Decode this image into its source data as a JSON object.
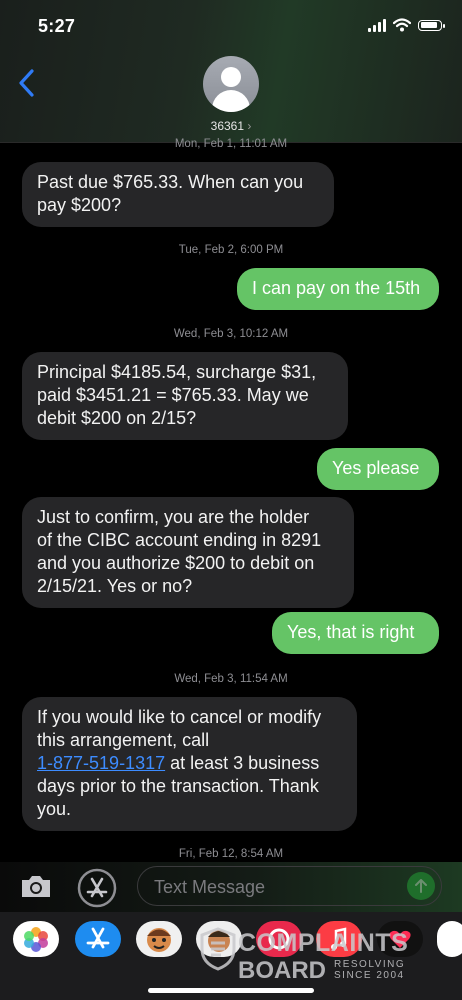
{
  "status_bar": {
    "time": "5:27"
  },
  "header": {
    "contact": "36361",
    "chevron": "›"
  },
  "messages": [
    {
      "type": "timestamp",
      "text": "Mon, Feb 1, 11:01 AM"
    },
    {
      "type": "incoming",
      "lines": [
        "Past due $765.33. When can you",
        "pay $200?"
      ]
    },
    {
      "type": "timestamp",
      "text": "Tue, Feb 2, 6:00 PM"
    },
    {
      "type": "outgoing",
      "text": "I can pay on the 15th"
    },
    {
      "type": "timestamp",
      "text": "Wed, Feb 3, 10:12 AM"
    },
    {
      "type": "incoming",
      "lines": [
        "Principal $4185.54, surcharge $31,",
        "paid $3451.21 = $765.33. May we",
        "debit $200 on 2/15?"
      ]
    },
    {
      "type": "outgoing",
      "text": "Yes please"
    },
    {
      "type": "incoming",
      "lines": [
        "Just to confirm, you are the holder",
        "of the CIBC account ending in 8291",
        "and you authorize $200 to debit on",
        "2/15/21. Yes or no?"
      ]
    },
    {
      "type": "outgoing",
      "text": "Yes, that is right"
    },
    {
      "type": "timestamp",
      "text": "Wed, Feb 3, 11:54 AM"
    },
    {
      "type": "incoming",
      "line1": "If you would like to cancel or modify",
      "line2": "this arrangement, call",
      "phone": "1-877-519-1317",
      "line3_rest": " at least 3 business",
      "line4": "days prior to the transaction. Thank",
      "line5": "you."
    },
    {
      "type": "timestamp",
      "text": "Fri, Feb 12, 8:54 AM"
    }
  ],
  "input": {
    "placeholder": "Text Message"
  },
  "icons": {
    "back": "chevron-left-icon",
    "camera": "camera-icon",
    "appstore": "app-store-icon",
    "send": "send-arrow-icon"
  },
  "colors": {
    "outgoing_bubble": "#65c466",
    "incoming_bubble": "#262628",
    "link": "#3d8cff",
    "accent_blue": "#2f7bf6"
  },
  "watermark": {
    "brand_line1": "COMPLAINTS",
    "brand_line2": "BOARD",
    "tagline_1": "RESOLVING",
    "tagline_2": "SINCE 2004"
  }
}
